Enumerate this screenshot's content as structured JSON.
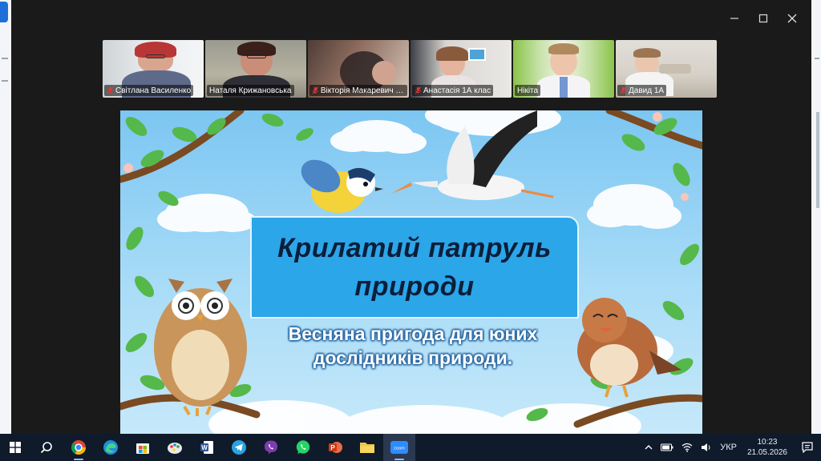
{
  "participants": [
    {
      "name": "Світлана Василенко",
      "muted": true,
      "active": false
    },
    {
      "name": "Наталя Крижановська",
      "muted": false,
      "active": true
    },
    {
      "name": "Вікторія Макаревич 1...",
      "muted": true,
      "active": false
    },
    {
      "name": "Анастасія 1А клас",
      "muted": true,
      "active": false
    },
    {
      "name": "Нікіта",
      "muted": false,
      "active": false
    },
    {
      "name": "Давид 1А",
      "muted": true,
      "active": false
    }
  ],
  "slide": {
    "title_line1": "Крилатий патруль",
    "title_line2": "природи",
    "subtitle_line1": "Весняна пригода для юних",
    "subtitle_line2": "дослідників природи."
  },
  "window_controls": {
    "minimize": "minimize-icon",
    "maximize": "maximize-icon",
    "close": "close-icon"
  },
  "taskbar": {
    "apps": [
      "windows-start",
      "search",
      "chrome",
      "edge",
      "microsoft-store",
      "paint",
      "word",
      "telegram",
      "viber",
      "whatsapp",
      "powerpoint",
      "file-explorer",
      "zoom"
    ],
    "zoom_label": "zoom",
    "language": "УКР",
    "time": "10:23",
    "date": "21.05.2026"
  },
  "colors": {
    "accent_green": "#3bd16f",
    "taskbar": "#0f1a2b",
    "title_box": "#2ba6e8",
    "mute_red": "#e5383b"
  }
}
